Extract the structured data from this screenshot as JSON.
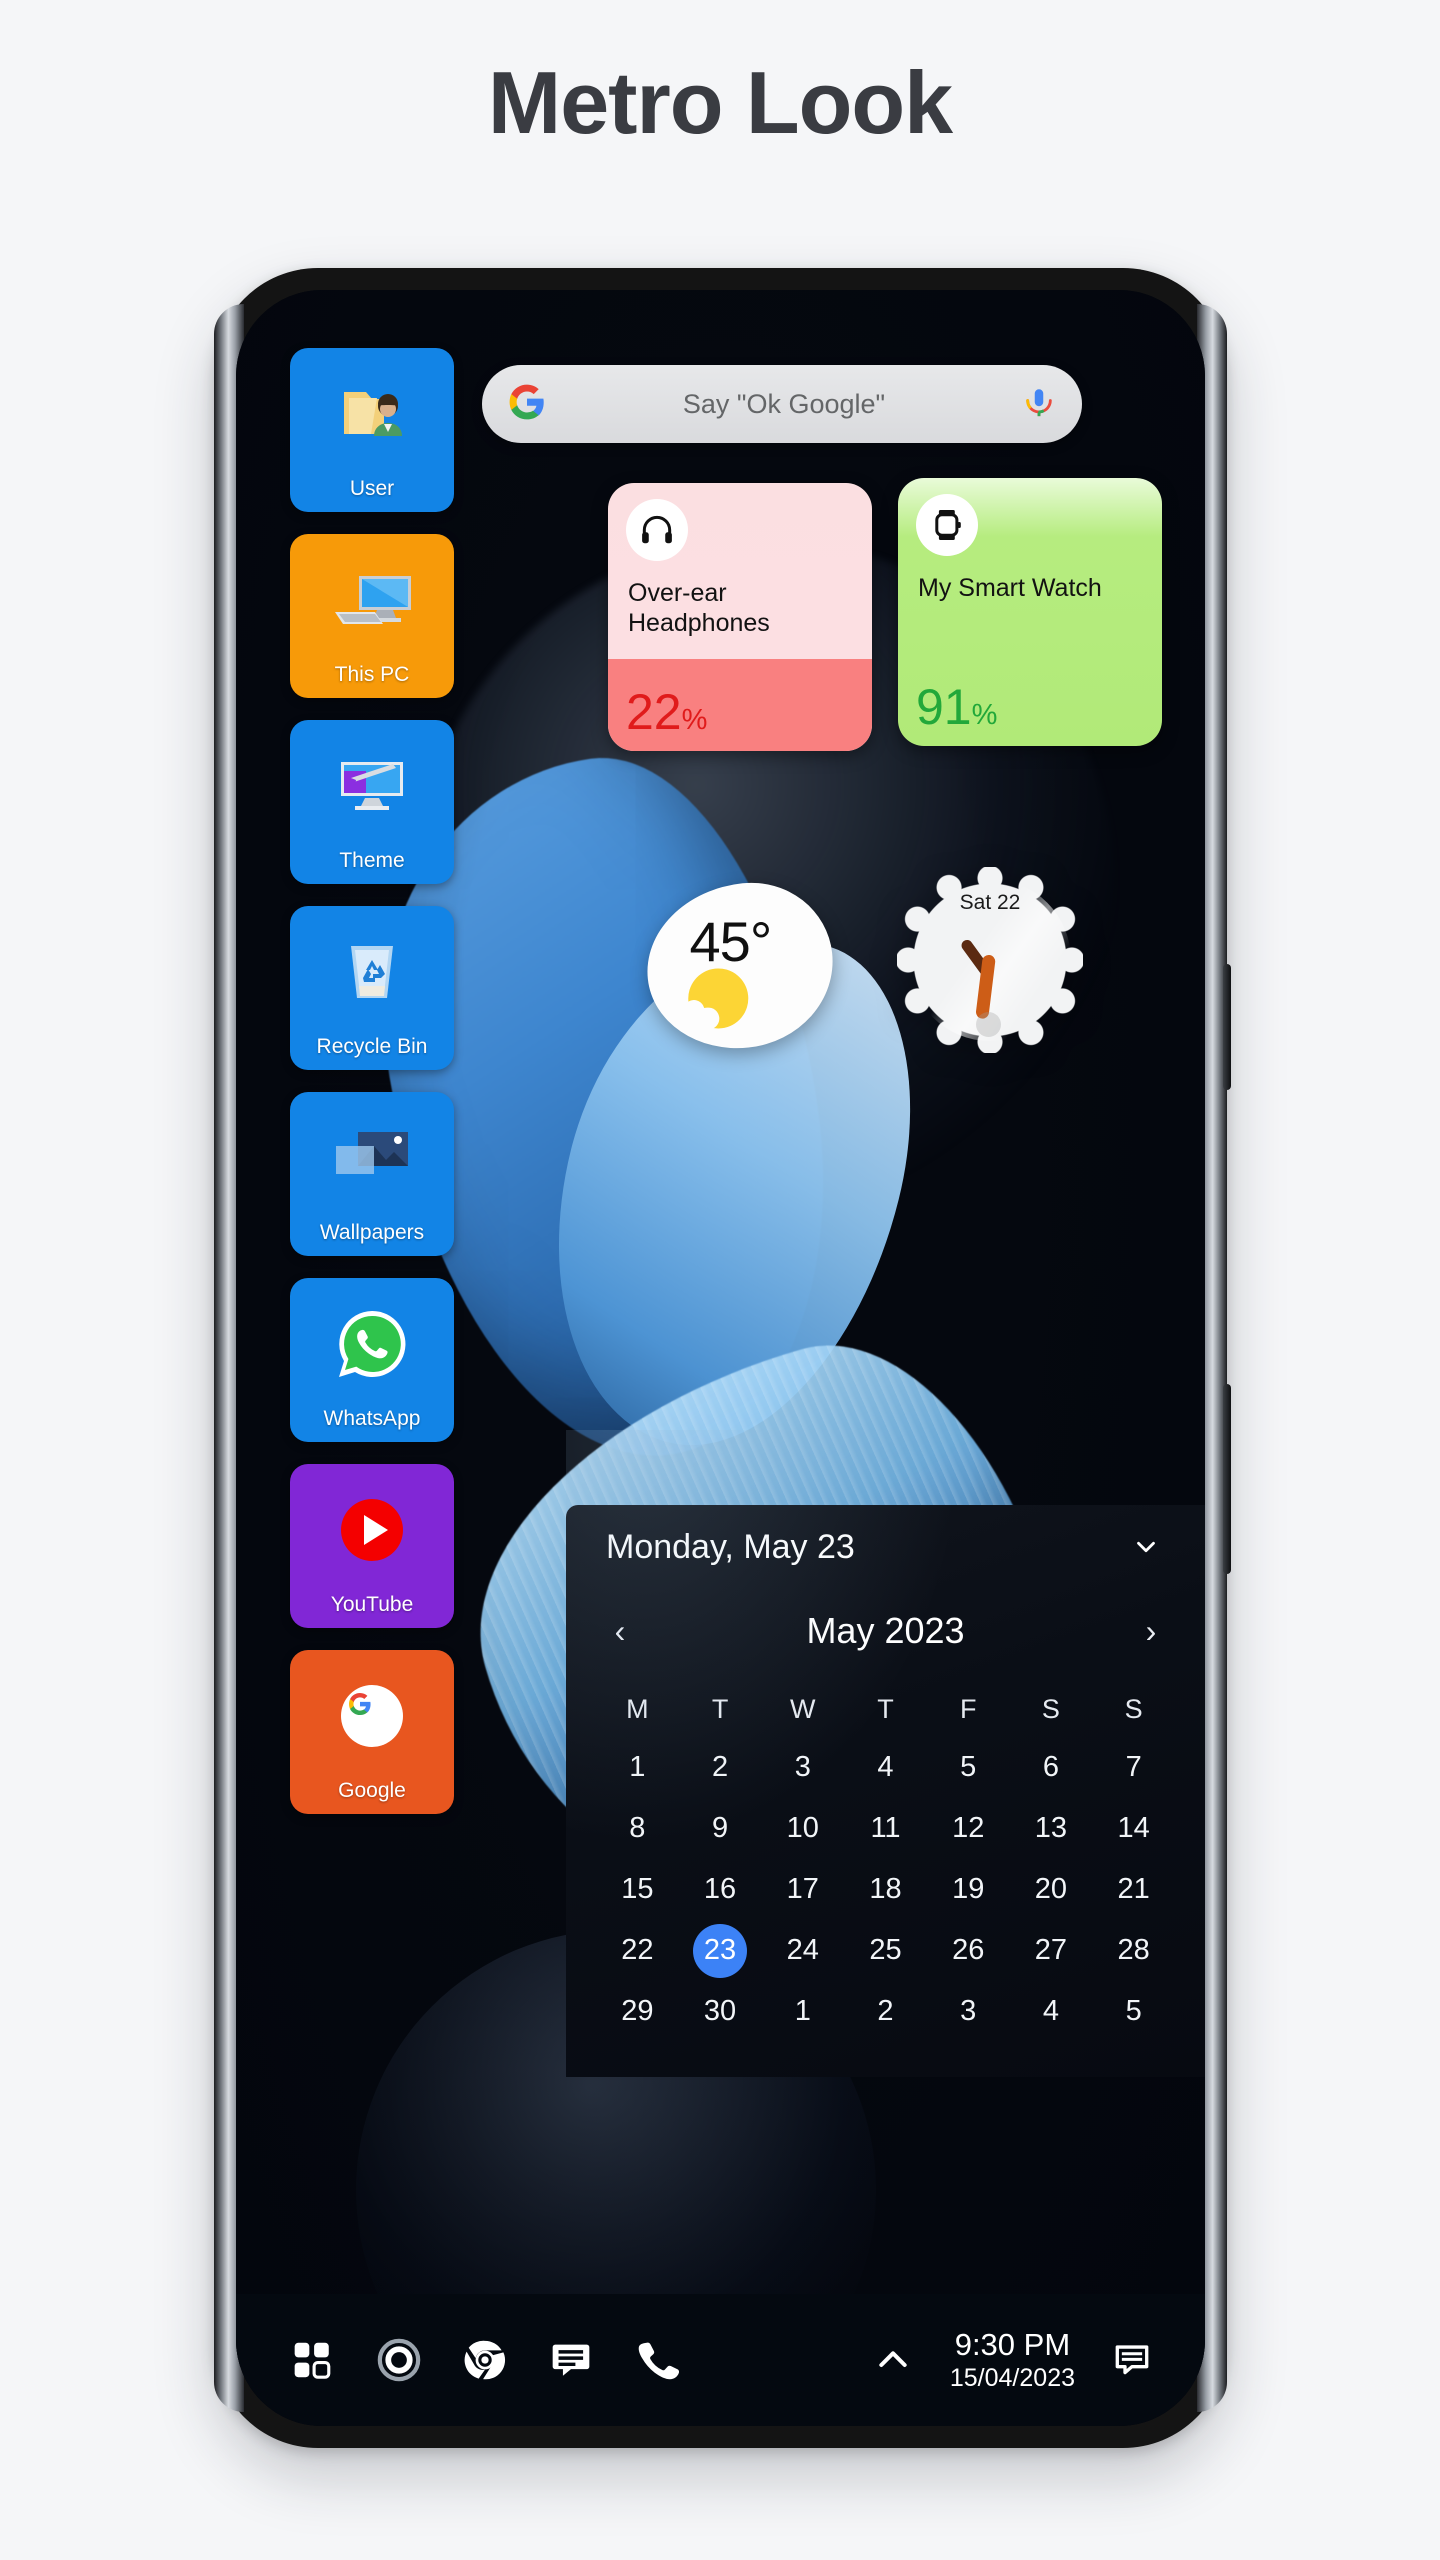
{
  "page": {
    "title": "Metro Look"
  },
  "search": {
    "icon": "google-g-icon",
    "placeholder": "Say \"Ok Google\"",
    "mic_icon": "microphone-icon"
  },
  "tiles": [
    {
      "label": "User",
      "icon": "user-folder-icon",
      "color": "#1284e6"
    },
    {
      "label": "This PC",
      "icon": "desktop-pc-icon",
      "color": "#f79a09"
    },
    {
      "label": "Theme",
      "icon": "theme-monitor-icon",
      "color": "#1284e6"
    },
    {
      "label": "Recycle Bin",
      "icon": "recycle-bin-icon",
      "color": "#1284e6"
    },
    {
      "label": "Wallpapers",
      "icon": "wallpapers-icon",
      "color": "#1284e6"
    },
    {
      "label": "WhatsApp",
      "icon": "whatsapp-icon",
      "color": "#1284e6"
    },
    {
      "label": "YouTube",
      "icon": "youtube-icon",
      "color": "#8127d6"
    },
    {
      "label": "Google",
      "icon": "google-g-icon",
      "color": "#e8561f"
    }
  ],
  "battery_widgets": [
    {
      "name": "Over-ear Headphones",
      "percent": "22",
      "percent_symbol": "%",
      "icon": "headphones-icon",
      "accent": "#e01b1b",
      "fill_color": "#f98080"
    },
    {
      "name": "My Smart Watch",
      "percent": "91",
      "percent_symbol": "%",
      "icon": "smartwatch-icon",
      "accent": "#22a83a",
      "fill_color": "#b1ea78"
    }
  ],
  "weather": {
    "temperature": "45°",
    "icon": "sun-behind-cloud-icon"
  },
  "clock": {
    "date_label": "Sat 22",
    "hour_hand_color": "#5b2a11",
    "minute_hand_color": "#cd5d17"
  },
  "calendar": {
    "today_label": "Monday, May 23",
    "collapse_icon": "chevron-down-icon",
    "prev_icon": "‹",
    "next_icon": "›",
    "month_label": "May 2023",
    "weekdays": [
      "M",
      "T",
      "W",
      "T",
      "F",
      "S",
      "S"
    ],
    "selected_day": "23",
    "selected_color": "#3c82f6",
    "weeks": [
      [
        "1",
        "2",
        "3",
        "4",
        "5",
        "6",
        "7"
      ],
      [
        "8",
        "9",
        "10",
        "11",
        "12",
        "13",
        "14"
      ],
      [
        "15",
        "16",
        "17",
        "18",
        "19",
        "20",
        "21"
      ],
      [
        "22",
        "23",
        "24",
        "25",
        "26",
        "27",
        "28"
      ],
      [
        "29",
        "30",
        "1",
        "2",
        "3",
        "4",
        "5"
      ]
    ]
  },
  "taskbar": {
    "icons": [
      {
        "name": "start-tiles-icon"
      },
      {
        "name": "cortana-circle-icon"
      },
      {
        "name": "chrome-icon"
      },
      {
        "name": "messages-icon"
      },
      {
        "name": "phone-icon"
      }
    ],
    "show_hidden_icon": "chevron-up-icon",
    "time": "9:30 PM",
    "date": "15/04/2023",
    "notification_icon": "notification-chat-icon"
  }
}
